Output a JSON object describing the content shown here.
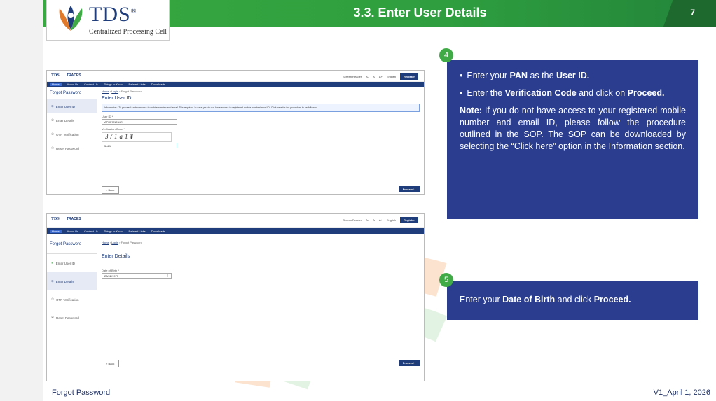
{
  "slide": {
    "title": "3.3. Enter User Details",
    "page_number": "7",
    "footer_left": "Forgot Password",
    "footer_right": "V1_April 1, 2026"
  },
  "logo": {
    "text": "TDS",
    "reg": "®",
    "subtitle": "Centralized Processing Cell"
  },
  "screen1": {
    "logo": "TDS",
    "app": "TRACES",
    "top_right": [
      "Screen Reader",
      "A-",
      "A",
      "A+",
      "English"
    ],
    "register": "Register",
    "nav": [
      "Home",
      "About Us",
      "Contact Us",
      "Things to Know",
      "Related Links",
      "Downloads"
    ],
    "side_title": "Forgot Password",
    "steps": [
      "Enter User ID",
      "Enter Details",
      "OTP Verification",
      "Reset Password"
    ],
    "breadcrumb": [
      "Home",
      "Login",
      "Forgot Password"
    ],
    "heading": "Enter User ID",
    "info": "Information : To proceed further access to mobile number and email ID is required. In case you do not have access to registered mobile number/email ID, Click here for the procedure to be followed.",
    "userid_label": "User ID *",
    "userid_value": "APKPM1234R",
    "captcha_label": "Verification Code *",
    "captcha_image": "3/1a1¥",
    "captcha_value": "5bZ1",
    "back": "Back",
    "proceed": "Proceed"
  },
  "screen2": {
    "logo": "TDS",
    "app": "TRACES",
    "top_right": [
      "Screen Reader",
      "A-",
      "A",
      "A+",
      "English"
    ],
    "register": "Register",
    "nav": [
      "Home",
      "About Us",
      "Contact Us",
      "Things to Know",
      "Related Links",
      "Downloads"
    ],
    "side_title": "Forgot Password",
    "steps": [
      "Enter User ID",
      "Enter Details",
      "OTP Verification",
      "Reset Password"
    ],
    "breadcrumb": [
      "Home",
      "Login",
      "Forgot Password"
    ],
    "heading": "Enter Details",
    "dob_label": "Date of Birth *",
    "dob_value": "28/02/1977",
    "back": "Back",
    "proceed": "Proceed"
  },
  "callout4": {
    "number": "4",
    "b1_pre": "Enter your ",
    "b1_bold1": "PAN",
    "b1_mid": " as the ",
    "b1_bold2": "User ID.",
    "b2_pre": "Enter the ",
    "b2_bold1": "Verification Code",
    "b2_mid": " and click on ",
    "b2_bold2": "Proceed.",
    "note_label": "Note:",
    "note_text": " If you do not have access to your registered mobile number and email ID, please follow the procedure outlined in the SOP. The SOP can be downloaded by selecting the “Click here” option in the Information section."
  },
  "callout5": {
    "number": "5",
    "pre": "Enter your ",
    "bold1": "Date of Birth",
    "mid": " and click ",
    "bold2": "Proceed."
  },
  "colors": {
    "header_green": "#38a840",
    "callout_blue": "#2a3d8f",
    "circle_green": "#3faa46",
    "traces_navy": "#1f3d7a"
  }
}
